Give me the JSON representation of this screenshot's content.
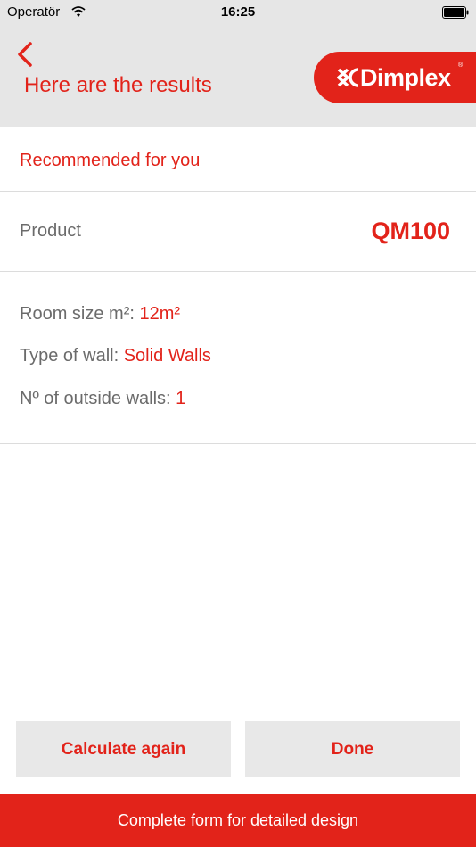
{
  "status": {
    "carrier": "Operatör",
    "time": "16:25"
  },
  "header": {
    "title": "Here are the results",
    "logo_text": "Dimplex",
    "logo_reg": "®"
  },
  "results": {
    "recommended_label": "Recommended for you",
    "product_label": "Product",
    "product_value": "QM100",
    "room_size_label": "Room size m²: ",
    "room_size_value": "12m²",
    "wall_type_label": "Type of wall: ",
    "wall_type_value": "Solid Walls",
    "outside_walls_label": "Nº of outside walls: ",
    "outside_walls_value": "1"
  },
  "actions": {
    "calculate_again": "Calculate again",
    "done": "Done",
    "complete_form": "Complete form for detailed design"
  },
  "colors": {
    "accent": "#e2231a",
    "header_bg": "#e6e6e6",
    "button_bg": "#e8e8e8"
  },
  "icons": {
    "back": "chevron-left-icon",
    "wifi": "wifi-icon",
    "battery": "battery-icon",
    "logo": "dimplex-logo-mark"
  }
}
